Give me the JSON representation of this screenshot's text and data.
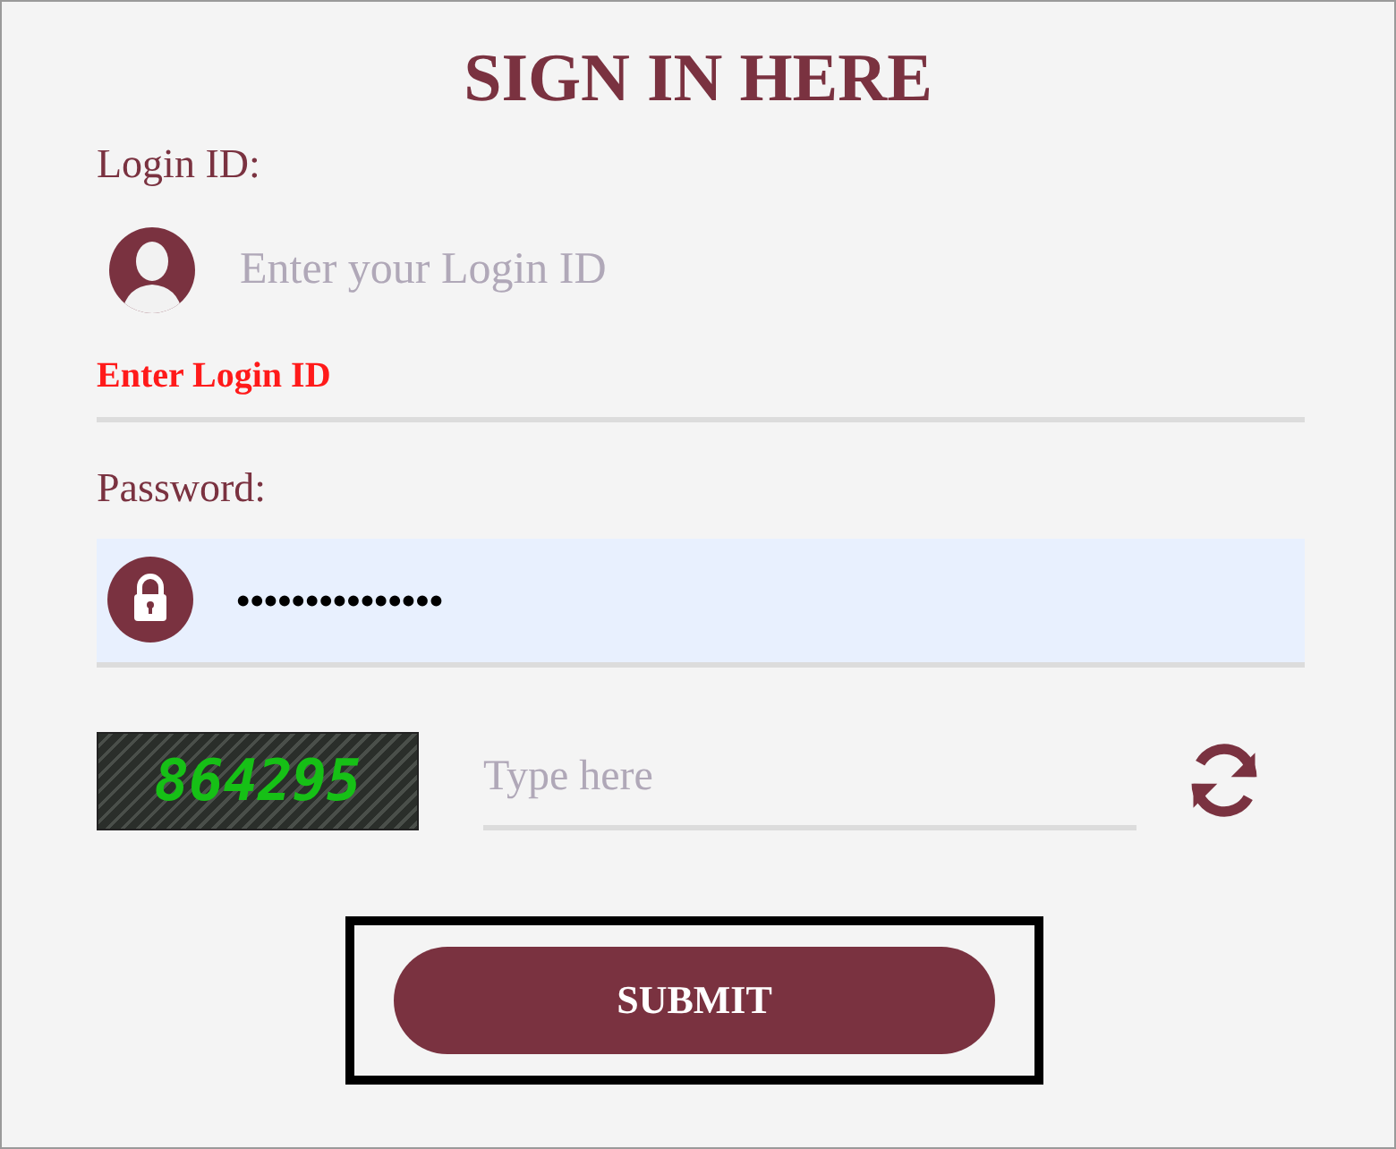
{
  "title": "SIGN IN HERE",
  "login": {
    "label": "Login ID:",
    "placeholder": "Enter your Login ID",
    "error": "Enter Login ID",
    "focused": false
  },
  "password": {
    "label": "Password:",
    "value": "•••••••••••••••",
    "focused": true
  },
  "captcha": {
    "code": "864295",
    "placeholder": "Type here"
  },
  "submit": {
    "label": "SUBMIT",
    "highlighted": true
  }
}
